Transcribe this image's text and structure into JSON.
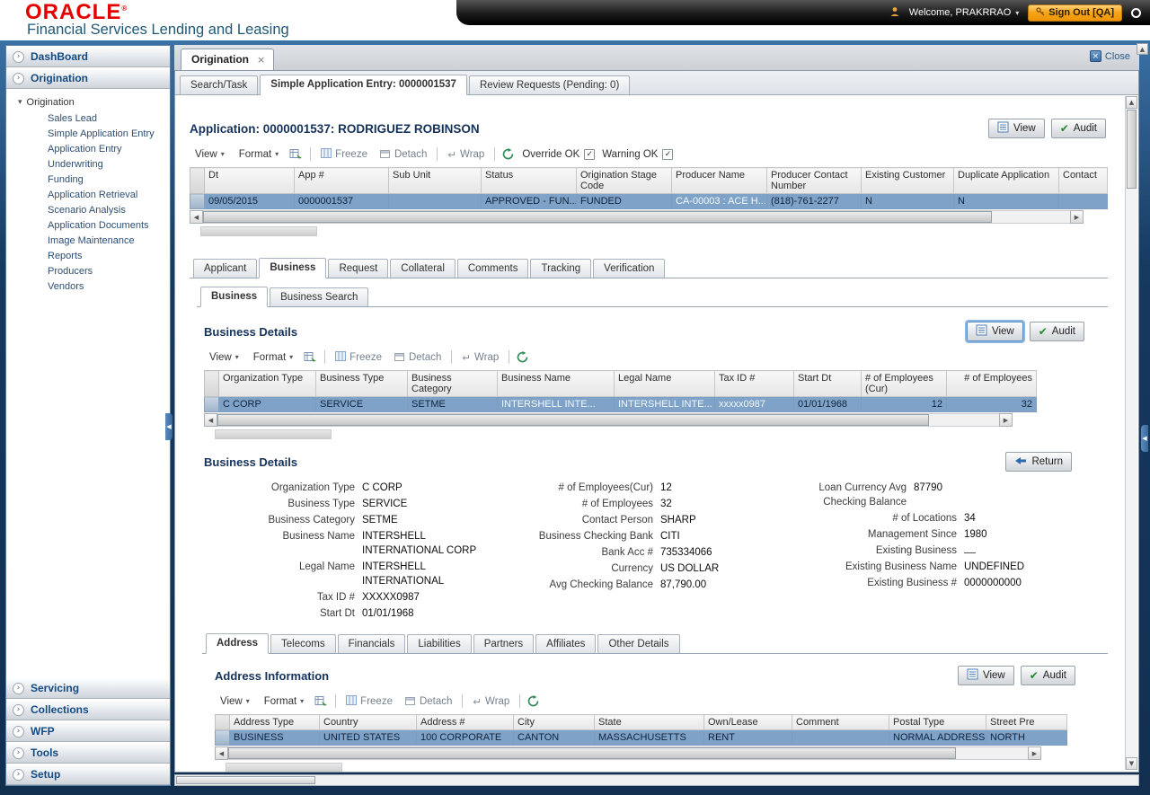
{
  "brand": {
    "logo": "ORACLE",
    "reg": "®",
    "subtitle": "Financial Services Lending and Leasing"
  },
  "topbar": {
    "welcome": "Welcome, PRAKRRAO",
    "signout": "Sign Out [QA]"
  },
  "sidebar": {
    "dashboard": "DashBoard",
    "origination": "Origination",
    "tree_root": "Origination",
    "tree_items": [
      "Sales Lead",
      "Simple Application Entry",
      "Application Entry",
      "Underwriting",
      "Funding",
      "Application Retrieval",
      "Scenario Analysis",
      "Application Documents",
      "Image Maintenance",
      "Reports",
      "Producers",
      "Vendors"
    ],
    "bottom": [
      "Servicing",
      "Collections",
      "WFP",
      "Tools",
      "Setup"
    ]
  },
  "wtab": {
    "label": "Origination",
    "close": "Close"
  },
  "ptabs": [
    "Search/Task",
    "Simple Application Entry: 0000001537",
    "Review Requests (Pending: 0)"
  ],
  "toolbar": {
    "view": "View",
    "format": "Format",
    "freeze": "Freeze",
    "detach": "Detach",
    "wrap": "Wrap",
    "override": "Override OK",
    "warning": "Warning OK"
  },
  "btns": {
    "view": "View",
    "audit": "Audit",
    "ret": "Return"
  },
  "app": {
    "title": "Application: 0000001537: RODRIGUEZ ROBINSON",
    "columns": [
      "Dt",
      "App #",
      "Sub Unit",
      "Status",
      "Origination Stage Code",
      "Producer Name",
      "Producer Contact Number",
      "Existing Customer",
      "Duplicate Application",
      "Contact"
    ],
    "row": [
      "09/05/2015",
      "0000001537",
      "",
      "APPROVED - FUN...",
      "FUNDED",
      "CA-00003 : ACE H...",
      "(818)-761-2277",
      "N",
      "N",
      ""
    ]
  },
  "rtabs": [
    "Applicant",
    "Business",
    "Request",
    "Collateral",
    "Comments",
    "Tracking",
    "Verification"
  ],
  "btabs": [
    "Business",
    "Business Search"
  ],
  "bgrid": {
    "title": "Business Details",
    "columns": [
      "Organization Type",
      "Business Type",
      "Business Category",
      "Business Name",
      "Legal Name",
      "Tax ID #",
      "Start Dt",
      "# of Employees (Cur)",
      "# of Employees"
    ],
    "row": [
      "C CORP",
      "SERVICE",
      "SETME",
      "INTERSHELL INTE...",
      "INTERSHELL INTE...",
      "xxxxx0987",
      "01/01/1968",
      "12",
      "32"
    ]
  },
  "bform": {
    "title": "Business Details",
    "col1": [
      {
        "label": "Organization Type",
        "value": "C CORP"
      },
      {
        "label": "Business Type",
        "value": "SERVICE"
      },
      {
        "label": "Business Category",
        "value": "SETME"
      },
      {
        "label": "Business Name",
        "value": "INTERSHELL INTERNATIONAL CORP"
      },
      {
        "label": "Legal Name",
        "value": "INTERSHELL INTERNATIONAL"
      },
      {
        "label": "Tax ID #",
        "value": "XXXXX0987"
      },
      {
        "label": "Start Dt",
        "value": "01/01/1968"
      }
    ],
    "col2": [
      {
        "label": "# of Employees(Cur)",
        "value": "12"
      },
      {
        "label": "# of Employees",
        "value": "32"
      },
      {
        "label": "Contact Person",
        "value": "SHARP"
      },
      {
        "label": "Business Checking Bank",
        "value": "CITI"
      },
      {
        "label": "Bank Acc #",
        "value": "735334066"
      },
      {
        "label": "Currency",
        "value": "US DOLLAR"
      },
      {
        "label": "Avg Checking Balance",
        "value": "87,790.00"
      }
    ],
    "col3": [
      {
        "label": "Loan Currency Avg Checking Balance",
        "value": "87790"
      },
      {
        "label": "# of Locations",
        "value": "34"
      },
      {
        "label": "Management Since",
        "value": "1980"
      },
      {
        "label": "Existing Business",
        "value": ""
      },
      {
        "label": "Existing Business Name",
        "value": "UNDEFINED"
      },
      {
        "label": "Existing Business #",
        "value": "0000000000"
      }
    ]
  },
  "atabs": [
    "Address",
    "Telecoms",
    "Financials",
    "Liabilities",
    "Partners",
    "Affiliates",
    "Other Details"
  ],
  "agrid": {
    "title": "Address Information",
    "columns": [
      "Address Type",
      "Country",
      "Address #",
      "City",
      "State",
      "Own/Lease",
      "Comment",
      "Postal Type",
      "Street Pre"
    ],
    "row": [
      "BUSINESS",
      "UNITED STATES",
      "100 CORPORATE",
      "CANTON",
      "MASSACHUSETTS",
      "RENT",
      "",
      "NORMAL ADDRESS",
      "NORTH"
    ]
  },
  "colors": {
    "oracle_red": "#e20000",
    "header_blue": "#1f5876",
    "accent_blue": "#134a81",
    "selected_row": "#7fa3c8",
    "signout_orange": "#f7a51b"
  }
}
